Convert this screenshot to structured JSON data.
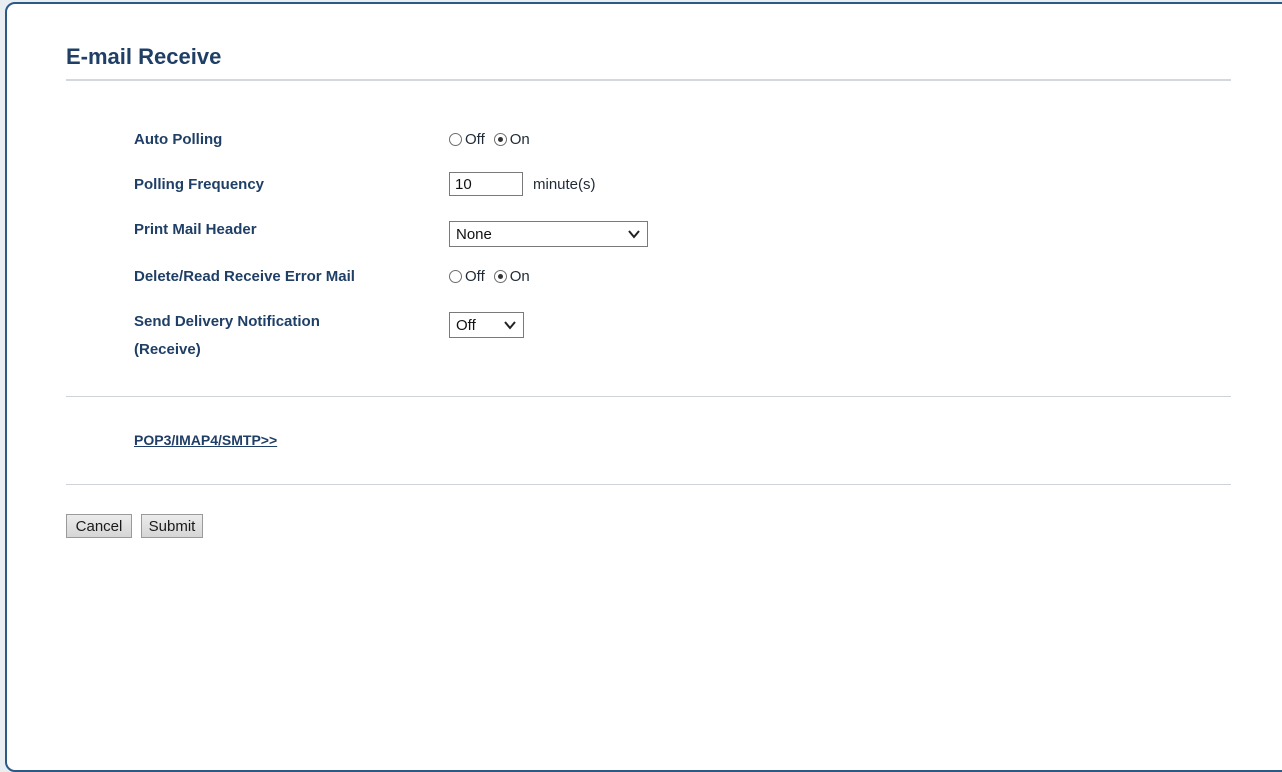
{
  "page": {
    "title": "E-mail Receive"
  },
  "settings": {
    "auto_polling": {
      "label": "Auto Polling",
      "options": [
        "Off",
        "On"
      ],
      "selected": "On"
    },
    "polling_frequency": {
      "label": "Polling Frequency",
      "value": "10",
      "unit": "minute(s)"
    },
    "print_mail_header": {
      "label": "Print Mail Header",
      "selected": "None"
    },
    "delete_read_error_mail": {
      "label": "Delete/Read Receive Error Mail",
      "options": [
        "Off",
        "On"
      ],
      "selected": "On"
    },
    "send_delivery_notification": {
      "label_line1": "Send Delivery Notification",
      "label_line2": "(Receive)",
      "selected": "Off"
    }
  },
  "links": {
    "pop3_imap4_smtp": "POP3/IMAP4/SMTP>>"
  },
  "buttons": {
    "cancel": "Cancel",
    "submit": "Submit"
  },
  "colors": {
    "heading": "#1f3f66",
    "panel_border": "#2c5a86"
  }
}
